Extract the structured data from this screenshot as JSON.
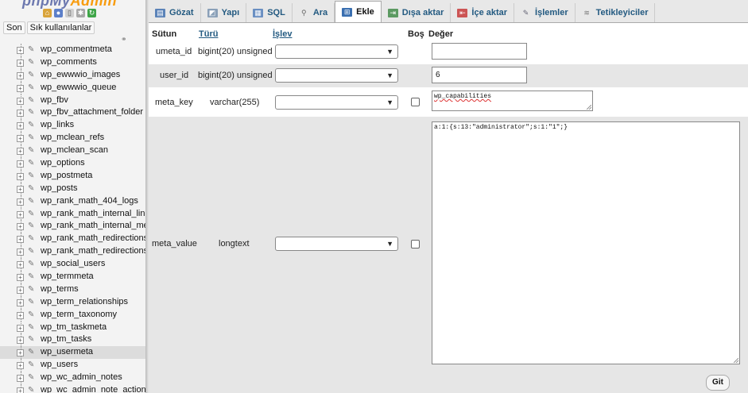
{
  "nav": {
    "logo_main": "phpMy",
    "logo_accent": "Admin",
    "tabs": [
      "Son",
      "Sık kullanılanlar"
    ],
    "tables": [
      "wp_commentmeta",
      "wp_comments",
      "wp_ewwwio_images",
      "wp_ewwwio_queue",
      "wp_fbv",
      "wp_fbv_attachment_folder",
      "wp_links",
      "wp_mclean_refs",
      "wp_mclean_scan",
      "wp_options",
      "wp_postmeta",
      "wp_posts",
      "wp_rank_math_404_logs",
      "wp_rank_math_internal_links",
      "wp_rank_math_internal_meta",
      "wp_rank_math_redirections",
      "wp_rank_math_redirections_cache",
      "wp_social_users",
      "wp_termmeta",
      "wp_terms",
      "wp_term_relationships",
      "wp_term_taxonomy",
      "wp_tm_taskmeta",
      "wp_tm_tasks",
      "wp_usermeta",
      "wp_users",
      "wp_wc_admin_notes",
      "wp_wc_admin_note_actions"
    ],
    "active_table": "wp_usermeta"
  },
  "tabs": [
    {
      "label": "Gözat",
      "icon": "browse-icon"
    },
    {
      "label": "Yapı",
      "icon": "structure-icon"
    },
    {
      "label": "SQL",
      "icon": "sql-icon"
    },
    {
      "label": "Ara",
      "icon": "search-icon"
    },
    {
      "label": "Ekle",
      "icon": "insert-icon",
      "active": true
    },
    {
      "label": "Dışa aktar",
      "icon": "export-icon"
    },
    {
      "label": "İçe aktar",
      "icon": "import-icon"
    },
    {
      "label": "İşlemler",
      "icon": "wrench-icon"
    },
    {
      "label": "Tetikleyiciler",
      "icon": "triggers-icon"
    }
  ],
  "form": {
    "headers": {
      "column": "Sütun",
      "type": "Türü",
      "function": "İşlev",
      "null": "Boş",
      "value": "Değer"
    },
    "rows": [
      {
        "column": "umeta_id",
        "type": "bigint(20) unsigned",
        "value": ""
      },
      {
        "column": "user_id",
        "type": "bigint(20) unsigned",
        "value": "6"
      },
      {
        "column": "meta_key",
        "type": "varchar(255)",
        "value": "wp_capabilities"
      },
      {
        "column": "meta_value",
        "type": "longtext",
        "value": "a:1:{s:13:\"administrator\";s:1:\"1\";}"
      }
    ],
    "go_label": "Git"
  },
  "colors": {
    "link": "#235a81",
    "row_alt": "#e6e6e6",
    "logo_blue": "#6c78af",
    "logo_orange": "#f89c0e"
  }
}
